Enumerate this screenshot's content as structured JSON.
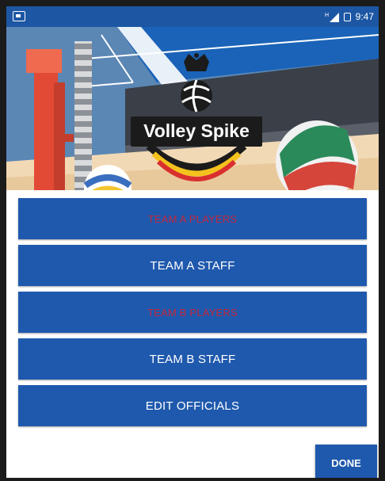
{
  "status_bar": {
    "time": "9:47",
    "network": "H",
    "icons": [
      "notification-icon",
      "signal-icon",
      "battery-icon"
    ]
  },
  "banner": {
    "app_title": "Volley Spike"
  },
  "menu": {
    "items": [
      {
        "label": "TEAM A PLAYERS",
        "state": "disabled"
      },
      {
        "label": "TEAM A STAFF",
        "state": "enabled"
      },
      {
        "label": "TEAM B PLAYERS",
        "state": "disabled"
      },
      {
        "label": "TEAM B STAFF",
        "state": "enabled"
      },
      {
        "label": "EDIT OFFICIALS",
        "state": "enabled"
      }
    ]
  },
  "footer": {
    "done_label": "DONE"
  },
  "colors": {
    "primary": "#1f59ad",
    "status_bar": "#1d57a4",
    "disabled_text": "#c2283d"
  }
}
